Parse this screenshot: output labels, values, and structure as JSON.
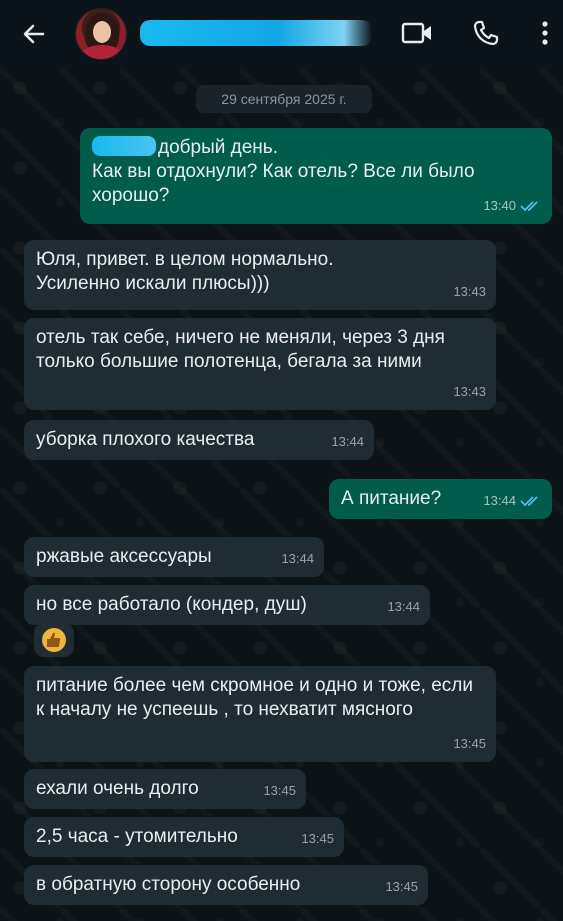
{
  "header": {
    "contact_name_redacted": true
  },
  "icons": {
    "back": "arrow-left-icon",
    "video": "video-camera-icon",
    "call": "phone-icon",
    "menu": "more-vertical-icon"
  },
  "date_separator": "29 сентября 2025 г.",
  "messages": [
    {
      "dir": "out",
      "text": "добрый день.\nКак вы отдохнули? Как отель? Все ли было хорошо?",
      "time": "13:40",
      "status": "read"
    },
    {
      "dir": "in",
      "text": "Юля, привет. в целом нормально. Усиленно искали плюсы)))",
      "time": "13:43"
    },
    {
      "dir": "in",
      "text": "отель так себе, ничего не меняли, через 3 дня только большие полотенца, бегала за ними",
      "time": "13:43"
    },
    {
      "dir": "in",
      "text": "уборка плохого качества",
      "time": "13:44"
    },
    {
      "dir": "out",
      "text": "А питание?",
      "time": "13:44",
      "status": "read"
    },
    {
      "dir": "in",
      "text": "ржавые аксессуары",
      "time": "13:44"
    },
    {
      "dir": "in",
      "text": "но все работало (кондер, душ)",
      "time": "13:44"
    },
    {
      "dir": "in",
      "text": "👍",
      "time": ""
    },
    {
      "dir": "in",
      "text": "питание более чем скромное и одно и тоже, если к началу не успеешь , то нехватит мясного",
      "time": "13:45"
    },
    {
      "dir": "in",
      "text": "ехали очень долго",
      "time": "13:45"
    },
    {
      "dir": "in",
      "text": "2,5 часа - утомительно",
      "time": "13:45"
    },
    {
      "dir": "in",
      "text": "в обратную сторону особенно",
      "time": "13:45"
    }
  ],
  "colors": {
    "incoming_bubble": "#202c33",
    "outgoing_bubble": "#005c4b",
    "read_tick": "#53bdeb"
  }
}
